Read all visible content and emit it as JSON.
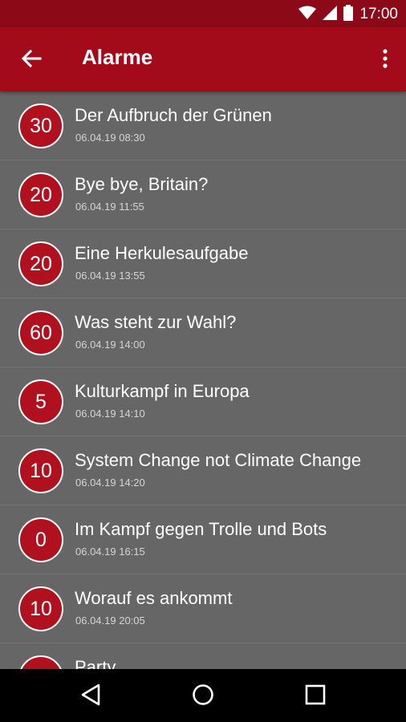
{
  "status": {
    "time": "17:00",
    "icons": [
      "wifi-icon",
      "signal-icon",
      "battery-icon"
    ]
  },
  "appbar": {
    "title": "Alarme",
    "back_icon": "arrow-left-icon",
    "menu_icon": "more-vert-icon"
  },
  "colors": {
    "appbar": "#a30b1b",
    "statusbar": "#8c0a18",
    "list_bg": "#666666",
    "badge": "#b1111f"
  },
  "alarms": [
    {
      "badge": "30",
      "title": "Der Aufbruch der Grünen",
      "time": "06.04.19 08:30"
    },
    {
      "badge": "20",
      "title": "Bye bye, Britain?",
      "time": "06.04.19 11:55"
    },
    {
      "badge": "20",
      "title": "Eine Herkulesaufgabe",
      "time": "06.04.19 13:55"
    },
    {
      "badge": "60",
      "title": "Was steht zur Wahl?",
      "time": "06.04.19 14:00"
    },
    {
      "badge": "5",
      "title": "Kulturkampf in Europa",
      "time": "06.04.19 14:10"
    },
    {
      "badge": "10",
      "title": "System Change not Climate Change",
      "time": "06.04.19 14:20"
    },
    {
      "badge": "0",
      "title": "Im Kampf gegen Trolle und Bots",
      "time": "06.04.19 16:15"
    },
    {
      "badge": "10",
      "title": "Worauf es ankommt",
      "time": "06.04.19 20:05"
    },
    {
      "badge": "",
      "title": "Party",
      "time": ""
    }
  ],
  "navbar": {
    "icons": [
      "back-triangle-icon",
      "home-circle-icon",
      "recents-square-icon"
    ]
  }
}
